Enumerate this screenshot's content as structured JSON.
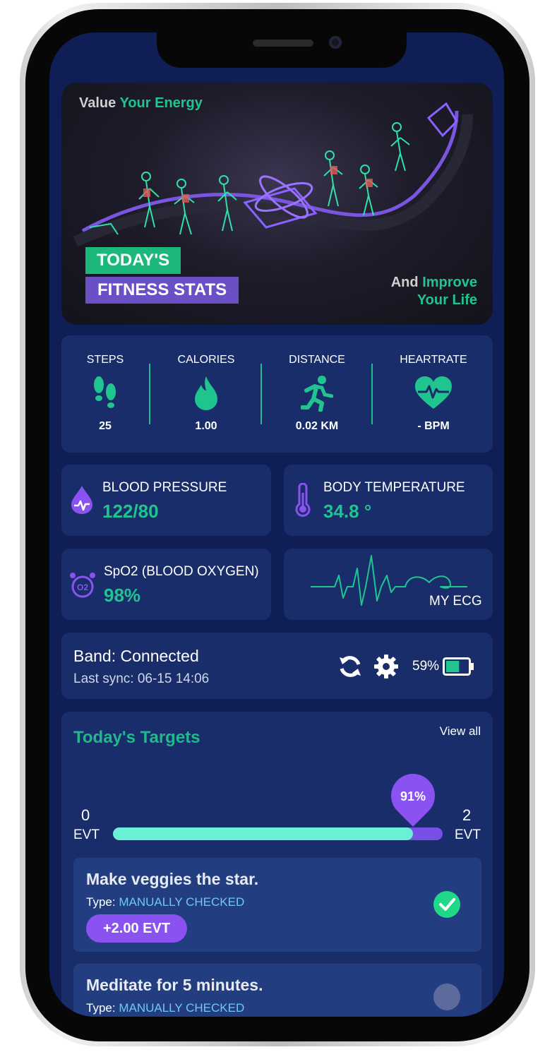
{
  "banner": {
    "top_word1": "Value",
    "top_word2": "Your Energy",
    "tag1": "TODAY'S",
    "tag2": "FITNESS STATS",
    "bottom_word1": "And",
    "bottom_word2": "Improve",
    "bottom_line2": "Your Life"
  },
  "stats": [
    {
      "label": "STEPS",
      "value": "25",
      "icon": "footprints-icon"
    },
    {
      "label": "CALORIES",
      "value": "1.00",
      "icon": "flame-icon"
    },
    {
      "label": "DISTANCE",
      "value": "0.02 KM",
      "icon": "runner-icon"
    },
    {
      "label": "HEARTRATE",
      "value": "- BPM",
      "icon": "heart-pulse-icon"
    }
  ],
  "metrics": {
    "blood_pressure": {
      "title": "BLOOD PRESSURE",
      "value": "122/80",
      "icon": "blood-drop-icon"
    },
    "body_temperature": {
      "title": "BODY TEMPERATURE",
      "value": "34.8 °",
      "icon": "thermometer-icon"
    },
    "spo2": {
      "title": "SpO2 (BLOOD OXYGEN)",
      "value": "98%",
      "icon": "oxygen-icon"
    },
    "ecg": {
      "label": "MY ECG",
      "icon": "ecg-wave-icon"
    }
  },
  "band": {
    "status": "Band: Connected",
    "last_sync": "Last sync: 06-15 14:06",
    "battery": "59%",
    "battery_level": 0.59
  },
  "targets": {
    "title": "Today's Targets",
    "view_all": "View all",
    "min": "0",
    "min_unit": "EVT",
    "max": "2",
    "max_unit": "EVT",
    "progress_label": "91%",
    "progress": 0.91,
    "tasks": [
      {
        "title": "Make veggies the star.",
        "type_label": "Type:",
        "type_value": "MANUALLY CHECKED",
        "reward": "+2.00 EVT",
        "done": true
      },
      {
        "title": "Meditate for 5 minutes.",
        "type_label": "Type:",
        "type_value": "MANUALLY CHECKED",
        "done": false
      }
    ]
  },
  "colors": {
    "accent_green": "#1fc48e",
    "accent_purple": "#8a52f0",
    "card_bg": "#1a2d6b",
    "screen_bg": "#0f1e55"
  }
}
